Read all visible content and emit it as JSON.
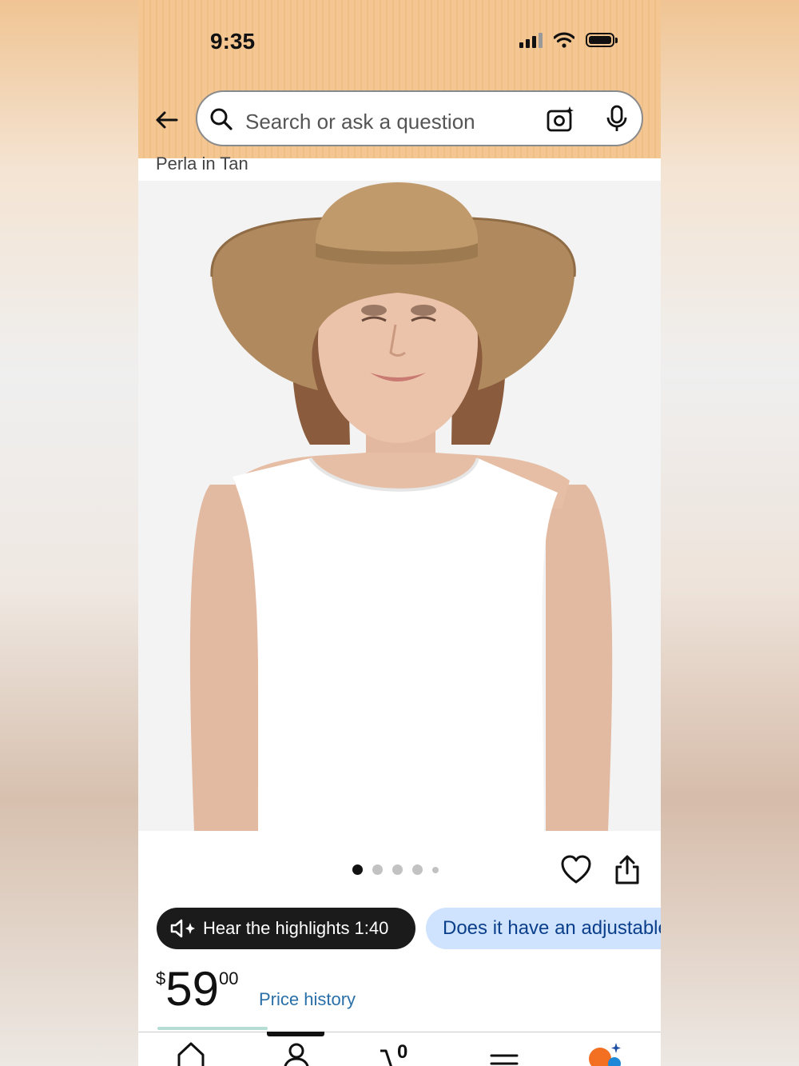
{
  "status_bar": {
    "time": "9:35"
  },
  "search": {
    "placeholder": "Search or ask a question"
  },
  "product": {
    "variant_text": "Perla in Tan",
    "image_count": 5,
    "active_image": 1
  },
  "actions": {
    "hear_highlights": "Hear the highlights 1:40",
    "question_chip": "Does it have an adjustable"
  },
  "price": {
    "currency": "$",
    "whole": "59",
    "fraction": "00",
    "history_link": "Price history"
  },
  "tabs": {
    "cart_count": "0"
  },
  "colors": {
    "header": "#f4c692",
    "link": "#2a6fa8",
    "chip_blue": "#cfe3ff",
    "hat": "#b08a5e"
  },
  "icons": [
    "back-arrow-icon",
    "search-icon",
    "camera-icon",
    "mic-icon",
    "heart-icon",
    "share-icon",
    "speaker-icon",
    "home-icon",
    "account-icon",
    "cart-icon",
    "menu-icon",
    "assistant-icon"
  ]
}
